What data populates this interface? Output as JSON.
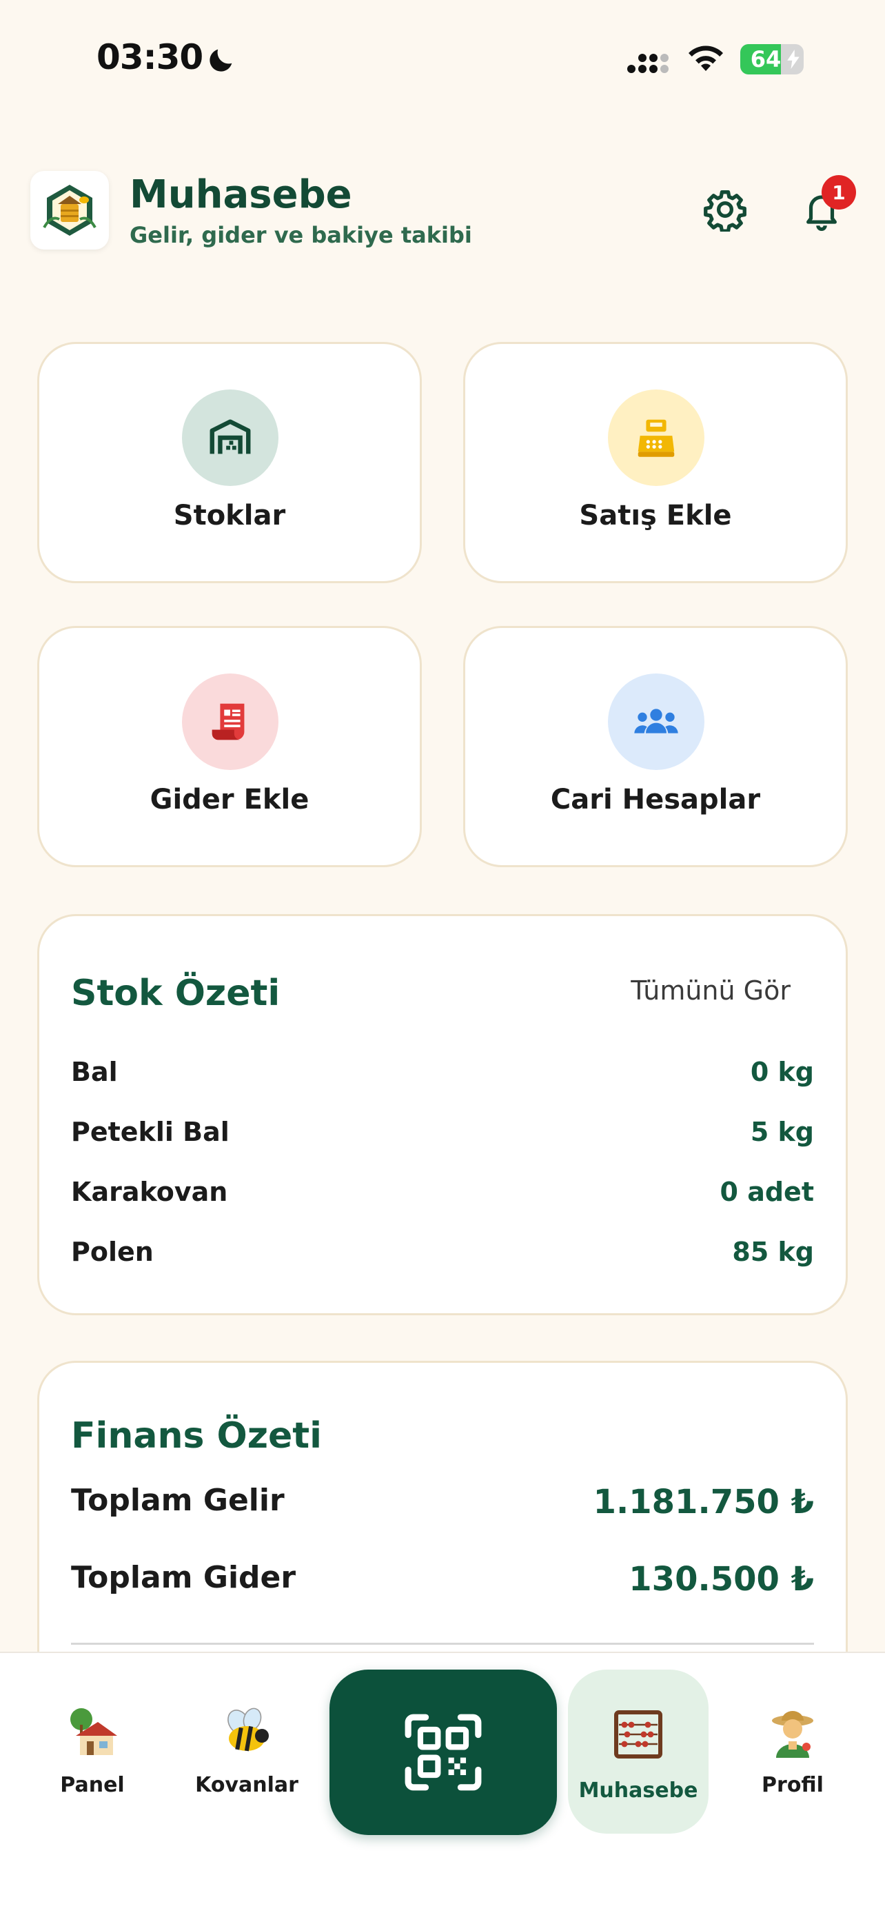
{
  "status_bar": {
    "time": "03:30",
    "battery_level": "64",
    "battery_fraction": 0.64
  },
  "header": {
    "title": "Muhasebe",
    "subtitle": "Gelir, gider ve bakiye takibi",
    "notification_count": "1"
  },
  "actions": [
    {
      "label": "Stoklar",
      "icon": "warehouse-icon",
      "color": "#d3e4dd"
    },
    {
      "label": "Satış Ekle",
      "icon": "cash-register-icon",
      "color": "#fff0c2"
    },
    {
      "label": "Gider Ekle",
      "icon": "receipt-icon",
      "color": "#fadadb"
    },
    {
      "label": "Cari Hesaplar",
      "icon": "people-icon",
      "color": "#dceafb"
    }
  ],
  "stock_summary": {
    "title": "Stok Özeti",
    "see_all": "Tümünü Gör",
    "items": [
      {
        "name": "Bal",
        "value": "0 kg"
      },
      {
        "name": "Petekli Bal",
        "value": "5 kg"
      },
      {
        "name": "Karakovan",
        "value": "0 adet"
      },
      {
        "name": "Polen",
        "value": "85 kg"
      }
    ]
  },
  "finance_summary": {
    "title": "Finans Özeti",
    "rows": [
      {
        "name": "Toplam Gelir",
        "value": "1.181.750 ₺"
      },
      {
        "name": "Toplam Gider",
        "value": "130.500 ₺"
      }
    ]
  },
  "bottom_nav": {
    "items": [
      {
        "label": "Panel",
        "icon": "house-icon"
      },
      {
        "label": "Kovanlar",
        "icon": "bee-icon"
      },
      {
        "label": "Muhasebe",
        "icon": "abacus-icon",
        "active": true
      },
      {
        "label": "Profil",
        "icon": "farmer-icon"
      }
    ],
    "scan_icon": "qr-scan-icon"
  },
  "colors": {
    "primary": "#0c513b",
    "background": "#fdf8f0",
    "badge": "#e02424"
  }
}
